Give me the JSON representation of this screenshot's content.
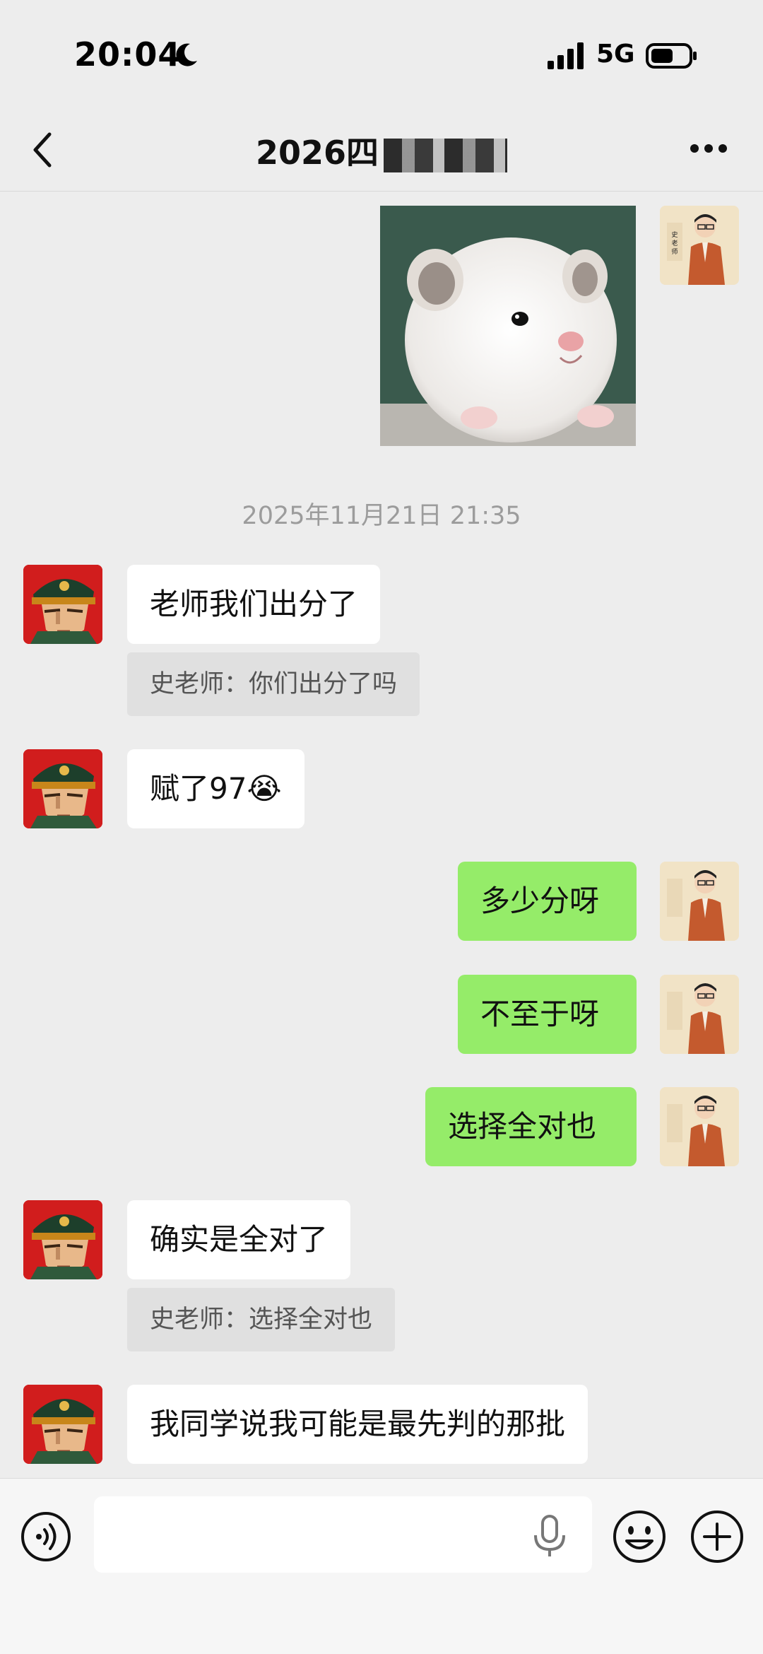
{
  "status_bar": {
    "time": "20:04",
    "network": "5G",
    "icons": [
      "moon-icon",
      "signal-icon",
      "battery-icon"
    ]
  },
  "nav": {
    "title": "2026四",
    "icons": [
      "back-icon",
      "more-icon"
    ]
  },
  "messages": [
    {
      "side": "right",
      "type": "image",
      "image": "hamster-sticker"
    },
    {
      "type": "timestamp",
      "text": "2025年11月21日 21:35"
    },
    {
      "side": "left",
      "text": "老师我们出分了",
      "quote": "史老师：你们出分了吗"
    },
    {
      "side": "left",
      "text": "赋了97",
      "emoji": "😭"
    },
    {
      "side": "right",
      "text": "多少分呀"
    },
    {
      "side": "right",
      "text": "不至于呀"
    },
    {
      "side": "right",
      "text": "选择全对也"
    },
    {
      "side": "left",
      "text": "确实是全对了",
      "quote": "史老师：选择全对也"
    },
    {
      "side": "left",
      "text": "我同学说我可能是最先判的那批"
    }
  ],
  "avatar_text": "史老师",
  "input_bar": {
    "value": "",
    "icons": [
      "voice-icon",
      "mic-icon",
      "emoji-icon",
      "plus-icon"
    ]
  },
  "colors": {
    "background": "#ededed",
    "bubble_self": "#95ec69",
    "bubble_other": "#ffffff",
    "quote_bg": "#e0e0e0"
  }
}
